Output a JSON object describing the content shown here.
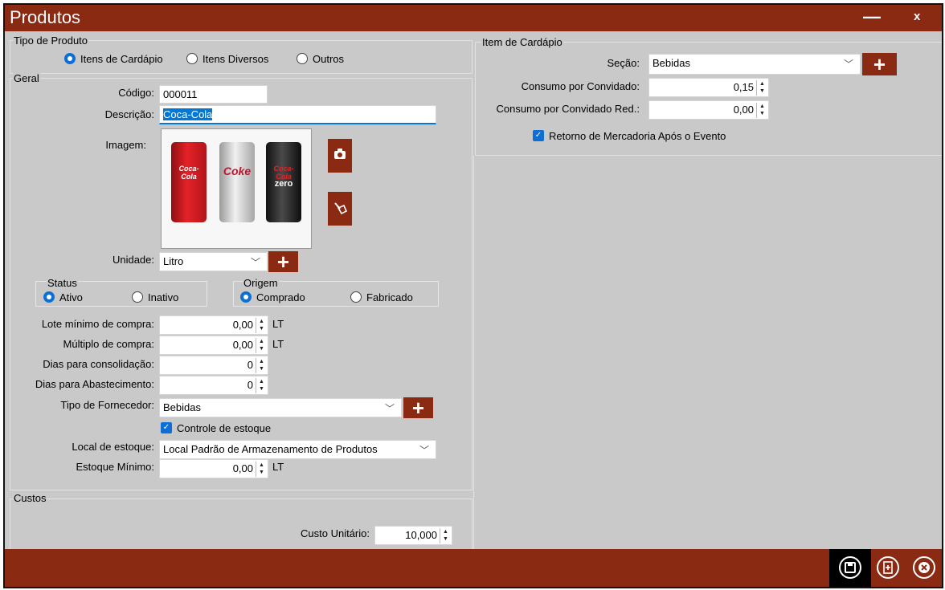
{
  "window": {
    "title": "Produtos",
    "minimize_label": "—",
    "close_label": "x"
  },
  "tipo_produto": {
    "legend": "Tipo de Produto",
    "options": [
      "Itens de Cardápio",
      "Itens Diversos",
      "Outros"
    ],
    "selected": "Itens de Cardápio"
  },
  "geral": {
    "legend": "Geral",
    "codigo_label": "Código:",
    "codigo_value": "000011",
    "descricao_label": "Descrição:",
    "descricao_value": "Coca-Cola",
    "imagem_label": "Imagem:",
    "can_labels": [
      "Coca-Cola",
      "Coke",
      "Coca-Cola"
    ],
    "can_sub": "zero",
    "unidade_label": "Unidade:",
    "unidade_value": "Litro",
    "status": {
      "legend": "Status",
      "options": [
        "Ativo",
        "Inativo"
      ],
      "selected": "Ativo"
    },
    "origem": {
      "legend": "Origem",
      "options": [
        "Comprado",
        "Fabricado"
      ],
      "selected": "Comprado"
    },
    "lote_label": "Lote mínimo de compra:",
    "lote_value": "0,00",
    "lote_unit": "LT",
    "multiplo_label": "Múltiplo de compra:",
    "multiplo_value": "0,00",
    "multiplo_unit": "LT",
    "dias_consol_label": "Dias para consolidação:",
    "dias_consol_value": "0",
    "dias_abast_label": "Dias para Abastecimento:",
    "dias_abast_value": "0",
    "tipo_fornecedor_label": "Tipo de Fornecedor:",
    "tipo_fornecedor_value": "Bebidas",
    "controle_estoque_label": "Controle de estoque",
    "controle_estoque_checked": true,
    "local_estoque_label": "Local de estoque:",
    "local_estoque_value": "Local Padrão de Armazenamento de Produtos",
    "estoque_minimo_label": "Estoque Mínimo:",
    "estoque_minimo_value": "0,00",
    "estoque_minimo_unit": "LT"
  },
  "custos": {
    "legend": "Custos",
    "custo_label": "Custo Unitário:",
    "custo_value": "10,000"
  },
  "item_cardapio": {
    "legend": "Item de Cardápio",
    "secao_label": "Seção:",
    "secao_value": "Bebidas",
    "consumo_label": "Consumo por Convidado:",
    "consumo_value": "0,15",
    "consumo_red_label": "Consumo por Convidado Red.:",
    "consumo_red_value": "0,00",
    "retorno_label": "Retorno de Mercadoria Após o Evento",
    "retorno_checked": true
  },
  "icons": {
    "camera": "camera-icon",
    "clear": "broom-icon",
    "add": "plus-icon",
    "save": "floppy-disk-icon",
    "new": "new-document-icon",
    "cancel": "close-circle-icon"
  },
  "colors": {
    "accent": "#8b2a13",
    "background": "#c9c9c9",
    "selection": "#0d6fd6"
  }
}
